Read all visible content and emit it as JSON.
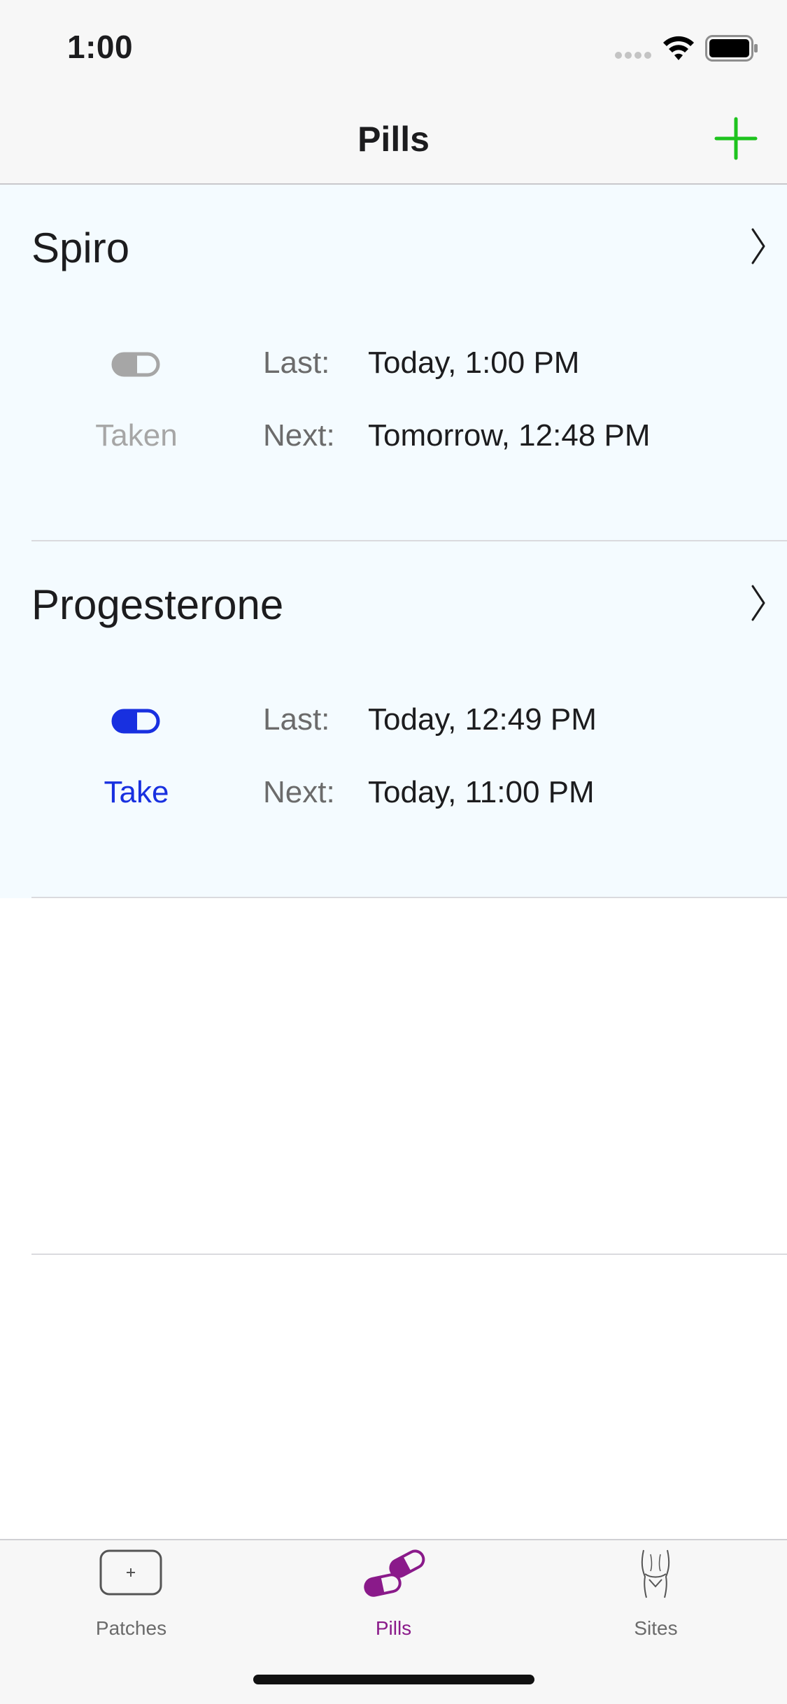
{
  "status_bar": {
    "time": "1:00",
    "icons": [
      "cellular-signal-icon",
      "wifi-icon",
      "battery-icon"
    ]
  },
  "nav": {
    "title": "Pills",
    "add_icon": "plus-icon",
    "accent_color": "#1ec31e"
  },
  "pills": [
    {
      "name": "Spiro",
      "action_label": "Taken",
      "action_state": "taken",
      "icon": "pill-capsule-icon",
      "icon_color": "#a6a6a6",
      "last_label": "Last:",
      "last_value": "Today, 1:00 PM",
      "next_label": "Next:",
      "next_value": "Tomorrow, 12:48 PM"
    },
    {
      "name": "Progesterone",
      "action_label": "Take",
      "action_state": "take",
      "icon": "pill-capsule-icon",
      "icon_color": "#1830e0",
      "last_label": "Last:",
      "last_value": "Today, 12:49 PM",
      "next_label": "Next:",
      "next_value": "Today, 11:00 PM"
    }
  ],
  "tab_bar": {
    "tabs": [
      {
        "label": "Patches",
        "icon": "patch-icon",
        "selected": false
      },
      {
        "label": "Pills",
        "icon": "pills-icon",
        "selected": true
      },
      {
        "label": "Sites",
        "icon": "body-sites-icon",
        "selected": false
      }
    ],
    "selected_color": "#8a1a8a"
  },
  "colors": {
    "cell_background": "#f4fbff",
    "bar_background": "#f7f7f7"
  }
}
